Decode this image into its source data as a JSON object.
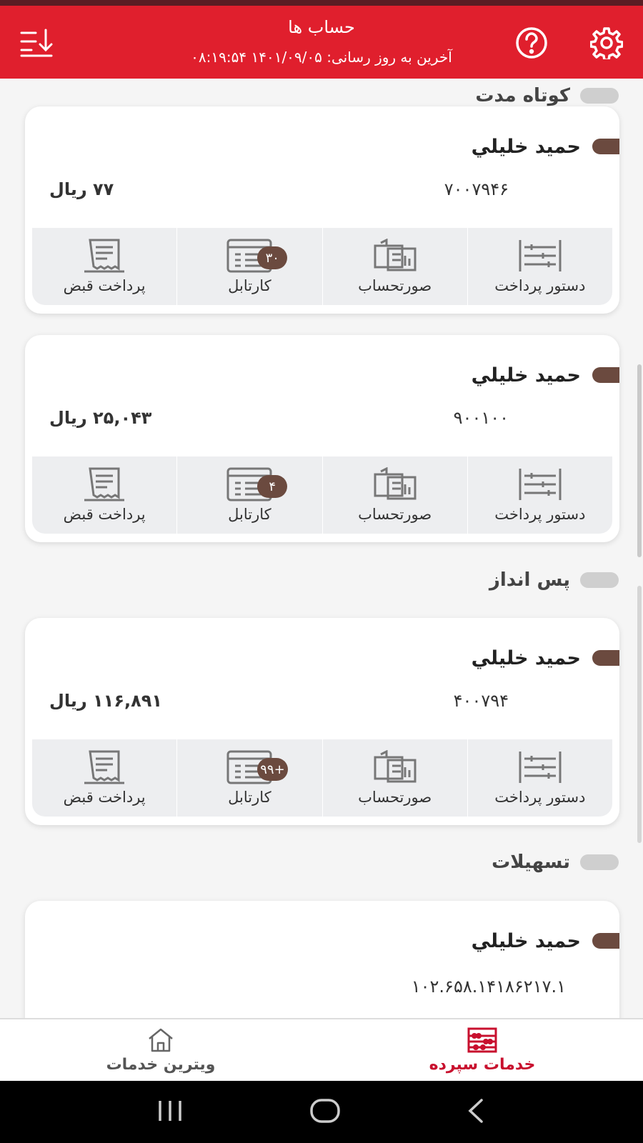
{
  "header": {
    "title": "حساب ها",
    "last_update_label": "آخرین به روز رسانی:",
    "last_update_value": "۱۴۰۱/۰۹/۰۵ ۰۸:۱۹:۵۴",
    "settings_icon": "gear-icon",
    "help_icon": "help-circle-icon",
    "sort_icon": "sort-download-icon"
  },
  "sections": {
    "short_term": "کوتاه مدت",
    "savings": "پس انداز",
    "facilities": "تسهیلات"
  },
  "actions": {
    "transfer": "دستور پرداخت",
    "statement": "صورتحساب",
    "cartable": "کارتابل",
    "bill": "پرداخت قبض"
  },
  "cards": [
    {
      "owner": "حمید خلیلي",
      "account": "۷۰۰۷۹۴۶",
      "balance": "۷۷ ریال",
      "badge": "۳۰"
    },
    {
      "owner": "حمید خلیلي",
      "account": "۹۰۰۱۰۰",
      "balance": "۲۵,۰۴۳ ریال",
      "badge": "۴"
    },
    {
      "owner": "حمید خلیلي",
      "account": "۴۰۰۷۹۴",
      "balance": "۱۱۶,۸۹۱ ریال",
      "badge": "+۹۹"
    },
    {
      "owner": "حمید خلیلي",
      "loan": "۱۰۲.۶۵۸.۱۴۱۸۶۲۱۷.۱"
    }
  ],
  "bottom_nav": {
    "deposit_services": "خدمات سپرده",
    "services_showcase": "ویترین خدمات"
  },
  "colors": {
    "brand_red": "#e01f2d",
    "brown_accent": "#6b4a3f"
  }
}
